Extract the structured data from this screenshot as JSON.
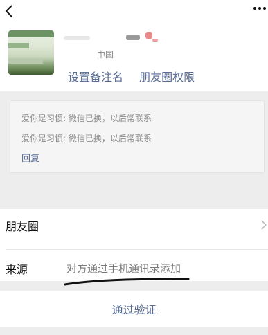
{
  "profile": {
    "region": "中国",
    "actions": [
      "设置备注名",
      "朋友圈权限"
    ]
  },
  "messages": {
    "items": [
      "爱你是习惯: 微信已换，以后常联系",
      "爱你是习惯: 微信已换，以后常联系"
    ],
    "reply": "回复"
  },
  "rows": {
    "moments": "朋友圈",
    "source_label": "来源",
    "source_value": "对方通过手机通讯录添加"
  },
  "actions": {
    "pass": "通过验证"
  },
  "icons": {
    "back": "chevron-left-icon",
    "more": "more-dots-icon",
    "chevron": "chevron-right-icon"
  },
  "colors": {
    "link": "#576b95",
    "background": "#ededed",
    "muted": "#8a8a8a"
  }
}
